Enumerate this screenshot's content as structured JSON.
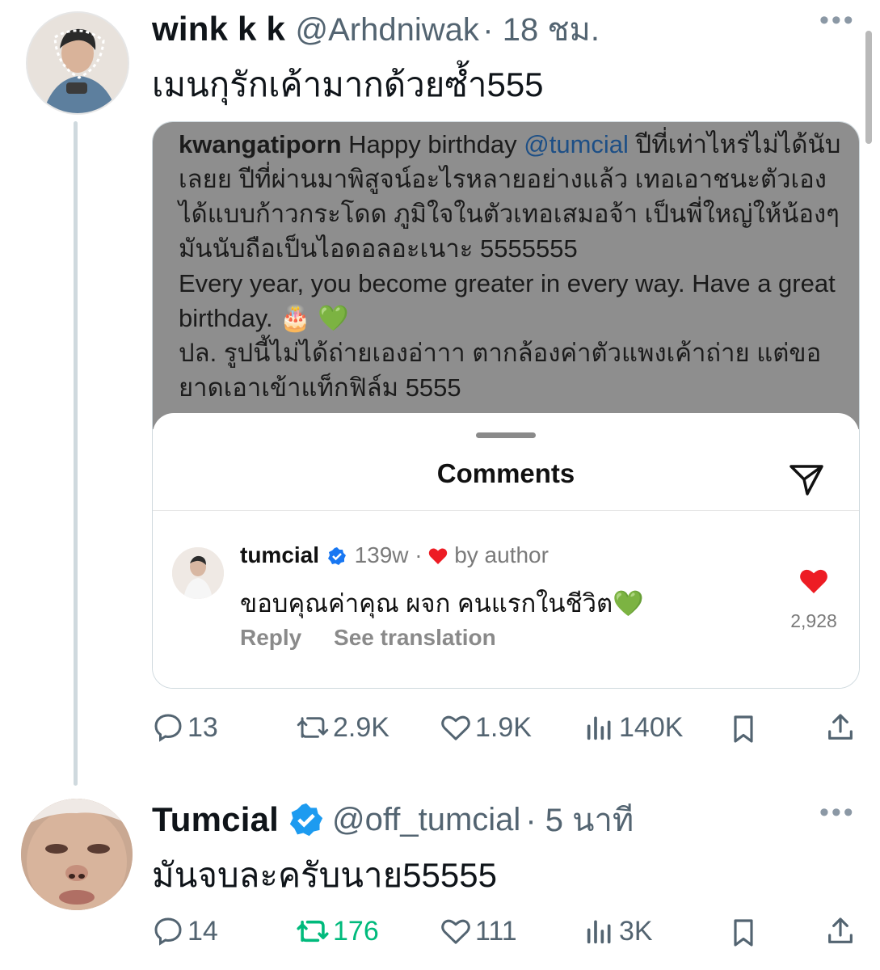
{
  "tweet1": {
    "name": "wink k k",
    "handle": "@Arhdniwak",
    "time": "· 18 ชม.",
    "text": "เมนกุรักเค้ามากด้วยซ้ำ555",
    "embedded": {
      "caption_user": "kwangatiporn",
      "caption_pre": " Happy birthday ",
      "caption_mention": "@tumcial",
      "caption_rest": " ปีที่เท่าไหร่ไม่ได้นับเลยย ปีที่ผ่านมาพิสูจน์อะไรหลายอย่างแล้ว เทอเอาชนะตัวเองได้แบบก้าวกระโดด ภูมิใจในตัวเทอเสมอจ้า เป็นพี่ใหญ่ให้น้องๆมันนับถือเป็นไอดอลอะเนาะ 5555555",
      "caption_en": "Every year, you become greater in every way. Have a great birthday. 🎂 💚",
      "caption_ps": "ปล. รูปนี้ไม่ได้ถ่ายเองอ่าาา ตากล้องค่าตัวแพงเค้าถ่าย แต่ขอยาดเอาเข้าแท็กฟิล์ม 5555",
      "sheet_title": "Comments",
      "comment": {
        "user": "tumcial",
        "age": "139w",
        "sep": " · ",
        "by_author": "by author",
        "text": "ขอบคุณค่าคุณ ผจก คนแรกในชีวิต💚",
        "reply": "Reply",
        "translate": "See translation",
        "likes": "2,928"
      }
    },
    "stats": {
      "replies": "13",
      "retweets": "2.9K",
      "likes": "1.9K",
      "views": "140K"
    }
  },
  "tweet2": {
    "name": "Tumcial",
    "handle": "@off_tumcial",
    "time": "· 5 นาที",
    "text": "มันจบละครับนาย55555",
    "stats": {
      "replies": "14",
      "retweets": "176",
      "likes": "111",
      "views": "3K"
    }
  },
  "colors": {
    "retweet_active": "#00ba7c",
    "verified": "#1d9bf0",
    "heart": "#ed1c24"
  },
  "icons": [
    "reply-icon",
    "retweet-icon",
    "like-icon",
    "views-icon",
    "bookmark-icon",
    "share-icon",
    "verified-badge-icon",
    "paper-plane-icon",
    "more-icon"
  ]
}
